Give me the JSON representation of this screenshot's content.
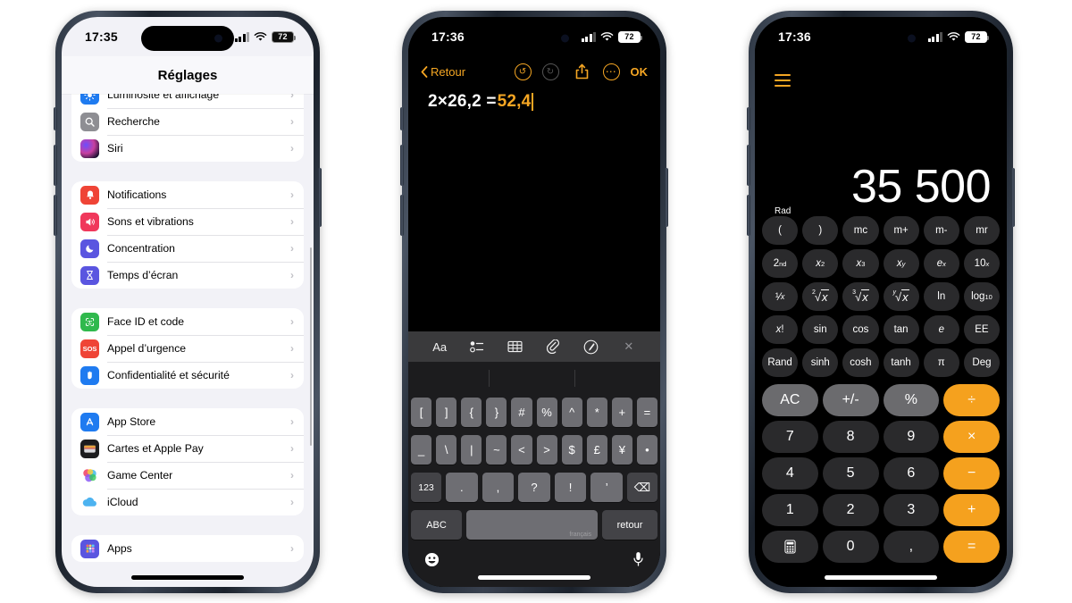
{
  "phone1": {
    "status": {
      "time": "17:35",
      "battery": "72",
      "signal_icon": "cellular-bars-icon",
      "wifi_icon": "wifi-icon"
    },
    "nav_title": "Réglages",
    "groups": [
      {
        "items": [
          {
            "label": "Luminosité et affichage",
            "icon": "brightness-icon",
            "color": "#1f7bf0"
          },
          {
            "label": "Recherche",
            "icon": "search-icon",
            "color": "#8e8e93"
          },
          {
            "label": "Siri",
            "icon": "siri-icon",
            "color": "#2b2352"
          }
        ]
      },
      {
        "items": [
          {
            "label": "Notifications",
            "icon": "bell-icon",
            "color": "#ef4436"
          },
          {
            "label": "Sons et vibrations",
            "icon": "speaker-icon",
            "color": "#f0385b"
          },
          {
            "label": "Concentration",
            "icon": "moon-icon",
            "color": "#5a55e0"
          },
          {
            "label": "Temps d’écran",
            "icon": "hourglass-icon",
            "color": "#5a55e0"
          }
        ]
      },
      {
        "items": [
          {
            "label": "Face ID et code",
            "icon": "faceid-icon",
            "color": "#30b94d"
          },
          {
            "label": "Appel d’urgence",
            "icon": "sos-icon",
            "color": "#ef4436"
          },
          {
            "label": "Confidentialité et sécurité",
            "icon": "hand-privacy-icon",
            "color": "#1f7bf0"
          }
        ]
      },
      {
        "items": [
          {
            "label": "App Store",
            "icon": "appstore-icon",
            "color": "#1f7bf0"
          },
          {
            "label": "Cartes et Apple Pay",
            "icon": "wallet-icon",
            "color": "#1c1c1e"
          },
          {
            "label": "Game Center",
            "icon": "gamecenter-icon",
            "color": "#ffffff"
          },
          {
            "label": "iCloud",
            "icon": "icloud-icon",
            "color": "#ffffff"
          }
        ]
      },
      {
        "items": [
          {
            "label": "Apps",
            "icon": "apps-grid-icon",
            "color": "#5a55e0"
          }
        ]
      }
    ],
    "chevron": "›"
  },
  "phone2": {
    "status": {
      "time": "17:36",
      "battery": "72"
    },
    "toolbar": {
      "back_label": "Retour",
      "back_icon": "chevron-left-icon",
      "undo_icon": "undo-icon",
      "redo_icon": "redo-icon",
      "share_icon": "share-icon",
      "more_icon": "more-ellipsis-icon",
      "done_label": "OK"
    },
    "note": {
      "expression": "2×26,2 =",
      "result": "52,4"
    },
    "format_bar": [
      {
        "label": "Aa",
        "name": "text-format-icon"
      },
      {
        "label": "",
        "name": "checklist-icon"
      },
      {
        "label": "",
        "name": "table-icon"
      },
      {
        "label": "",
        "name": "attachment-icon"
      },
      {
        "label": "",
        "name": "markup-pen-icon"
      },
      {
        "label": "✕",
        "name": "close-icon"
      }
    ],
    "keyboard": {
      "row1": [
        "[",
        "]",
        "{",
        "}",
        "#",
        "%",
        "^",
        "*",
        "+",
        "="
      ],
      "row2": [
        "_",
        "\\",
        "|",
        "~",
        "<",
        ">",
        "$",
        "£",
        "¥",
        "•"
      ],
      "row3_num": "123",
      "row3": [
        ".",
        ",",
        "?",
        "!",
        "’"
      ],
      "row3_backspace": "⌫",
      "abc_label": "ABC",
      "space_hint": "français",
      "return_label": "retour",
      "emoji_icon": "emoji-icon",
      "mic_icon": "microphone-icon"
    }
  },
  "phone3": {
    "status": {
      "time": "17:36",
      "battery": "72"
    },
    "history_icon": "history-list-icon",
    "display_value": "35 500",
    "angle_mode": "Rad",
    "rows": [
      [
        {
          "l": "(",
          "t": "fn"
        },
        {
          "l": ")",
          "t": "fn"
        },
        {
          "l": "mc",
          "t": "fn"
        },
        {
          "l": "m+",
          "t": "fn"
        },
        {
          "l": "m-",
          "t": "fn"
        },
        {
          "l": "mr",
          "t": "fn"
        }
      ],
      [
        {
          "l": "2nd",
          "t": "fn"
        },
        {
          "l": "x²",
          "t": "fn"
        },
        {
          "l": "x³",
          "t": "fn"
        },
        {
          "l": "xʸ",
          "t": "fn"
        },
        {
          "l": "eˣ",
          "t": "fn"
        },
        {
          "l": "10ˣ",
          "t": "fn"
        }
      ],
      [
        {
          "l": "¹⁄x",
          "t": "fn"
        },
        {
          "l": "²√x",
          "t": "fn"
        },
        {
          "l": "³√x",
          "t": "fn"
        },
        {
          "l": "ʸ√x",
          "t": "fn"
        },
        {
          "l": "ln",
          "t": "fn"
        },
        {
          "l": "log₁₀",
          "t": "fn"
        }
      ],
      [
        {
          "l": "x!",
          "t": "fn"
        },
        {
          "l": "sin",
          "t": "fn"
        },
        {
          "l": "cos",
          "t": "fn"
        },
        {
          "l": "tan",
          "t": "fn"
        },
        {
          "l": "e",
          "t": "fn"
        },
        {
          "l": "EE",
          "t": "fn"
        }
      ],
      [
        {
          "l": "Rand",
          "t": "fn"
        },
        {
          "l": "sinh",
          "t": "fn"
        },
        {
          "l": "cosh",
          "t": "fn"
        },
        {
          "l": "tanh",
          "t": "fn"
        },
        {
          "l": "π",
          "t": "fn"
        },
        {
          "l": "Deg",
          "t": "fn"
        }
      ]
    ],
    "keypad": [
      [
        {
          "l": "AC",
          "t": "light"
        },
        {
          "l": "+/-",
          "t": "light"
        },
        {
          "l": "%",
          "t": "light"
        },
        {
          "l": "÷",
          "t": "orange"
        }
      ],
      [
        {
          "l": "7",
          "t": "dark"
        },
        {
          "l": "8",
          "t": "dark"
        },
        {
          "l": "9",
          "t": "dark"
        },
        {
          "l": "×",
          "t": "orange"
        }
      ],
      [
        {
          "l": "4",
          "t": "dark"
        },
        {
          "l": "5",
          "t": "dark"
        },
        {
          "l": "6",
          "t": "dark"
        },
        {
          "l": "−",
          "t": "orange"
        }
      ],
      [
        {
          "l": "1",
          "t": "dark"
        },
        {
          "l": "2",
          "t": "dark"
        },
        {
          "l": "3",
          "t": "dark"
        },
        {
          "l": "+",
          "t": "orange"
        }
      ],
      [
        {
          "l": "calculator",
          "t": "dark"
        },
        {
          "l": "0",
          "t": "dark"
        },
        {
          "l": ",",
          "t": "dark"
        },
        {
          "l": "=",
          "t": "orange"
        }
      ]
    ]
  },
  "colors": {
    "accent_orange": "#f5a11e",
    "ios_blue": "#1f7bf0",
    "settings_bg": "#f2f2f7"
  }
}
